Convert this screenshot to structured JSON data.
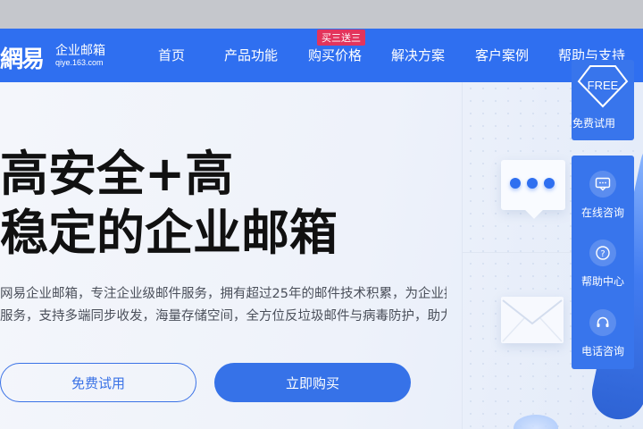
{
  "brand": {
    "logo_glyph": "網易",
    "product_name": "企业邮箱",
    "domain": "qiye.163.com"
  },
  "nav": {
    "items": [
      {
        "label": "首页"
      },
      {
        "label": "产品功能"
      },
      {
        "label": "购买价格"
      },
      {
        "label": "解决方案"
      },
      {
        "label": "客户案例"
      },
      {
        "label": "帮助与支持"
      }
    ],
    "promo_badge": "买三送三"
  },
  "hero": {
    "title_line1": "高安全+高",
    "title_line2": "稳定的企业邮箱",
    "desc_line1": "网易企业邮箱，专注企业级邮件服务，拥有超过25年的邮件技术积累，为企业提供安全稳定、高效便捷的商务邮箱",
    "desc_line2": "服务，支持多端同步收发，海量存储空间，全方位反垃圾邮件与病毒防护，助力企业高效沟通协作",
    "btn_outline": "免费试用",
    "btn_primary": "立即购买"
  },
  "side": {
    "free_badge": "FREE",
    "free_label": "免费试用",
    "items": [
      {
        "icon": "chat-icon",
        "label": "在线咨询"
      },
      {
        "icon": "help-icon",
        "label": "帮助中心"
      },
      {
        "icon": "headset-icon",
        "label": "电话咨询"
      }
    ]
  },
  "colors": {
    "primary": "#2f6ff0",
    "promo": "#e3345c",
    "side_panel": "#3875ec"
  }
}
